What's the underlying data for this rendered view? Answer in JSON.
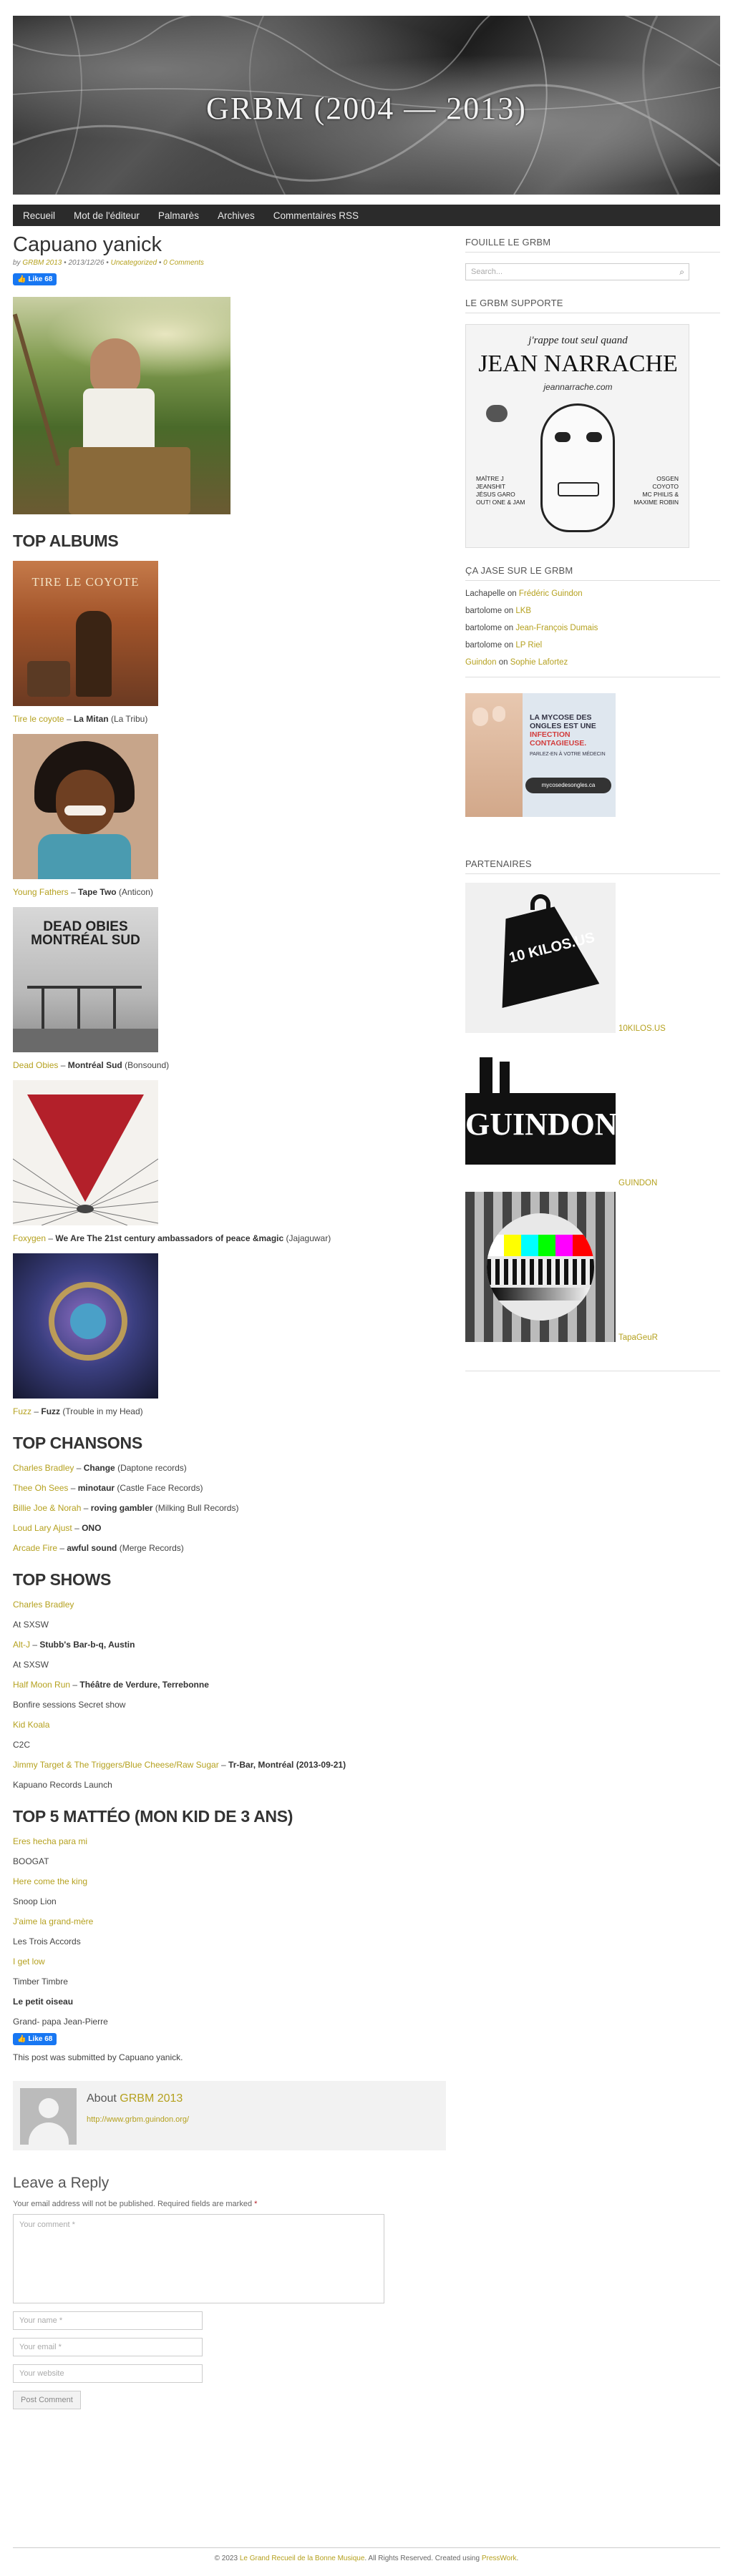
{
  "site": {
    "banner_title": "GRBM (2004 — 2013)",
    "nav": [
      "Recueil",
      "Mot de l'éditeur",
      "Palmarès",
      "Archives",
      "Commentaires RSS"
    ]
  },
  "post": {
    "title": "Capuano yanick",
    "meta": {
      "by": "by",
      "author": "GRBM 2013",
      "date": "2013/12/26",
      "sep": "•",
      "category": "Uncategorized",
      "comments": "0 Comments"
    },
    "fb_like_label": "Like 68",
    "sections": {
      "albums": "TOP ALBUMS",
      "chansons": "TOP CHANSONS",
      "shows": "TOP SHOWS",
      "kid": "TOP 5 MATTÉO (MON KID DE 3 ANS)"
    },
    "albums": [
      {
        "artist": "Tire le coyote",
        "title": "La Mitan",
        "label": "(La Tribu)"
      },
      {
        "artist": "Young Fathers",
        "title": "Tape Two",
        "label": "(Anticon)"
      },
      {
        "artist": "Dead Obies",
        "title": "Montréal Sud",
        "label": "(Bonsound)"
      },
      {
        "artist": "Foxygen",
        "title": "We Are The 21st century ambassadors of peace &magic",
        "label": "(Jajaguwar)"
      },
      {
        "artist": "Fuzz",
        "title": "Fuzz",
        "label": "(Trouble in my Head)"
      }
    ],
    "chansons": [
      {
        "artist": "Charles Bradley",
        "title": "Change",
        "label": "(Daptone records)"
      },
      {
        "artist": "Thee Oh Sees",
        "title": "minotaur",
        "label": "(Castle Face Records)"
      },
      {
        "artist": "Billie Joe & Norah",
        "title": "roving gambler",
        "label": "(Milking Bull Records)"
      },
      {
        "artist": "Loud Lary Ajust",
        "title": "ONO",
        "label": ""
      },
      {
        "artist": "Arcade Fire",
        "title": "awful sound",
        "label": "(Merge Records)"
      }
    ],
    "shows": [
      {
        "artist": "Charles Bradley",
        "venue": "",
        "detail": "At SXSW"
      },
      {
        "artist": "Alt-J",
        "venue": "Stubb's Bar-b-q, Austin",
        "detail": "At SXSW"
      },
      {
        "artist": "Half Moon Run",
        "venue": "Théâtre de Verdure, Terrebonne",
        "detail": "Bonfire sessions Secret show"
      },
      {
        "artist": "Kid Koala",
        "venue": "",
        "detail": "C2C"
      },
      {
        "artist": "Jimmy Target & The Triggers/Blue Cheese/Raw Sugar",
        "venue": "Tr-Bar, Montréal (2013-09-21)",
        "detail": "Kapuano Records Launch"
      }
    ],
    "kid": [
      {
        "song": "Eres hecha para mi",
        "artist": "BOOGAT",
        "linked": true
      },
      {
        "song": "Here come the king",
        "artist": "Snoop Lion",
        "linked": true
      },
      {
        "song": "J'aime la grand-mère",
        "artist": "Les Trois Accords",
        "linked": true
      },
      {
        "song": "I get low",
        "artist": "Timber Timbre",
        "linked": true
      },
      {
        "song": "Le petit oiseau",
        "artist": "Grand- papa Jean-Pierre",
        "linked": false
      }
    ],
    "submitted": "This post was submitted by Capuano yanick.",
    "author_box": {
      "about": "About",
      "name": "GRBM 2013",
      "url": "http://www.grbm.guindon.org/"
    }
  },
  "reply": {
    "heading": "Leave a Reply",
    "note": "Your email address will not be published. Required fields are marked",
    "required_mark": "*",
    "comment_placeholder": "Your comment *",
    "name_placeholder": "Your name *",
    "email_placeholder": "Your email *",
    "website_placeholder": "Your website",
    "submit_label": "Post Comment"
  },
  "sidebar": {
    "search_heading": "FOUILLE LE GRBM",
    "search_placeholder": "Search...",
    "support_heading": "LE GRBM SUPPORTE",
    "support_image": {
      "top": "j'rappe tout seul quand",
      "name": "JEAN NARRACHE",
      "site": "jeannarrache.com",
      "left_lines": [
        "MAÎTRE J",
        "JEANSHIT",
        "JÉSUS GARO",
        "OUT! ONE & JAM"
      ],
      "right_lines": [
        "OSGEN",
        "COYOTO",
        "MC PHILIS &",
        "MAXIME ROBIN"
      ]
    },
    "comments_heading": "ÇA JASE SUR LE GRBM",
    "comments": [
      {
        "who": "Lachapelle",
        "on": "on",
        "post": "Frédéric Guindon",
        "who_linked": false
      },
      {
        "who": "bartolome",
        "on": "on",
        "post": "LKB",
        "who_linked": false
      },
      {
        "who": "bartolome",
        "on": "on",
        "post": "Jean-François Dumais",
        "who_linked": false
      },
      {
        "who": "bartolome",
        "on": "on",
        "post": "LP Riel",
        "who_linked": false
      },
      {
        "who": "Guindon",
        "on": "on",
        "post": "Sophie Lafortez",
        "who_linked": true
      }
    ],
    "ad": {
      "line1": "LA MYCOSE DES",
      "line2": "ONGLES EST UNE",
      "line3": "INFECTION",
      "line4": "CONTAGIEUSE.",
      "line5": "PARLEZ-EN À VOTRE MÉDECIN",
      "site": "mycosedesongles.ca"
    },
    "partners_heading": "PARTENAIRES",
    "partners": [
      {
        "label": "10KILOS.US",
        "image_text": "10 KILOS.US"
      },
      {
        "label": "GUINDON",
        "image_text": "GUINDON"
      },
      {
        "label": "TapaGeuR",
        "image_text": ""
      }
    ]
  },
  "footer": {
    "prefix": "© 2023",
    "site": "Le Grand Recueil de la Bonne Musique",
    "middle": ". All Rights Reserved. Created using",
    "theme": "PressWork",
    "suffix": "."
  },
  "colors": {
    "accent": "#b5a11f",
    "nav_bg": "#2b2b2b",
    "fb": "#1877f2"
  }
}
